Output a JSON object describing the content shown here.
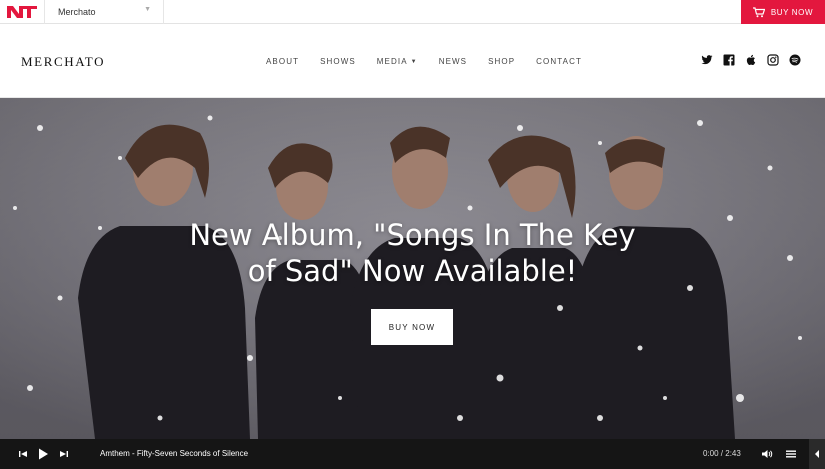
{
  "topbar": {
    "logo_icon": "nt-logo-icon",
    "theme_selected": "Merchato",
    "buy_now": "BUY NOW",
    "accent_color": "#e3173e"
  },
  "header": {
    "site_title": "MERCHATO",
    "nav": [
      {
        "label": "ABOUT"
      },
      {
        "label": "SHOWS"
      },
      {
        "label": "MEDIA",
        "has_dropdown": true
      },
      {
        "label": "NEWS"
      },
      {
        "label": "SHOP"
      },
      {
        "label": "CONTACT"
      }
    ],
    "social_icons": [
      "twitter-icon",
      "facebook-icon",
      "apple-icon",
      "instagram-icon",
      "spotify-icon"
    ]
  },
  "hero": {
    "title_line1": "New Album, \"Songs In The Key",
    "title_line2": "of Sad\" Now Available!",
    "button": "BUY NOW"
  },
  "player": {
    "track": "Amthem - Fifty-Seven Seconds of Silence",
    "time": "0:00 / 2:43",
    "icons": [
      "prev-icon",
      "play-icon",
      "next-icon",
      "volume-icon",
      "playlist-icon",
      "collapse-arrow-icon"
    ]
  }
}
